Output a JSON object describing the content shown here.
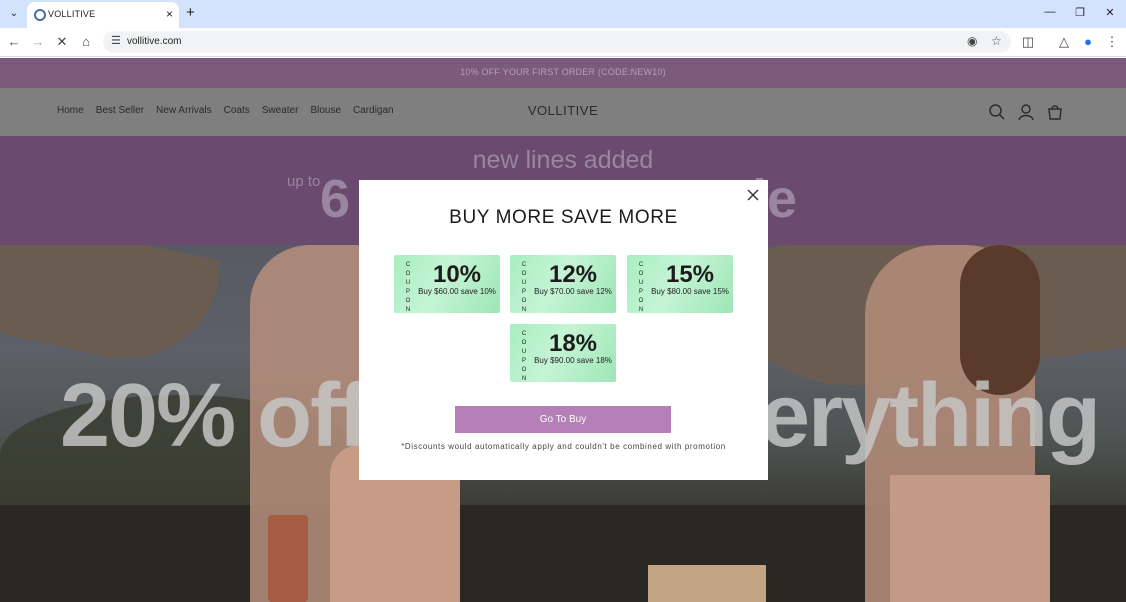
{
  "browser": {
    "tab_title": "VOLLITIVE",
    "url": "vollitive.com"
  },
  "site": {
    "promo": "10% OFF YOUR FIRST ORDER (CODE:NEW10)",
    "logo": "VOLLITIVE",
    "nav": [
      "Home",
      "Best Seller",
      "New Arrivals",
      "Coats",
      "Sweater",
      "Blouse",
      "Cardigan"
    ],
    "hero_line": "new lines added",
    "hero_upto": "up to",
    "hero_big_left": "6",
    "hero_big_right": "le",
    "hero_banner_left": "20% off",
    "hero_banner_right": "erything"
  },
  "modal": {
    "title": "BUY MORE SAVE MORE",
    "coupon_word": "C\nO\nU\nP\nO\nN",
    "coupons": [
      {
        "percent": "10%",
        "desc": "Buy $60.00 save 10%"
      },
      {
        "percent": "12%",
        "desc": "Buy $70.00 save 12%"
      },
      {
        "percent": "15%",
        "desc": "Buy $80.00 save 15%"
      },
      {
        "percent": "18%",
        "desc": "Buy $90.00 save 18%"
      }
    ],
    "button_label": "Go To Buy",
    "note": "*Discounts would automatically apply and couldn't be combined with promotion"
  },
  "colors": {
    "promo_bar": "#7b5a7e",
    "coupon_green": "#a8eec0",
    "button": "#b57fb8"
  }
}
